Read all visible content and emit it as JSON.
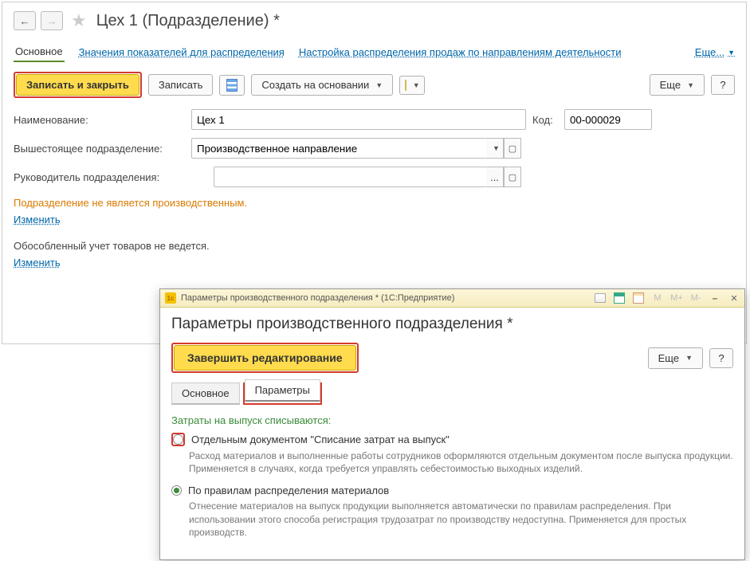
{
  "main": {
    "title": "Цех 1 (Подразделение) *",
    "tabs": {
      "main": "Основное",
      "link1": "Значения показателей для распределения",
      "link2": "Настройка распределения продаж по направлениям деятельности",
      "more": "Еще..."
    },
    "toolbar": {
      "save_close": "Записать и закрыть",
      "save": "Записать",
      "create_on": "Создать на основании",
      "more": "Еще",
      "help": "?"
    },
    "fields": {
      "name_label": "Наименование:",
      "name_value": "Цех 1",
      "code_label": "Код:",
      "code_value": "00-000029",
      "parent_label": "Вышестоящее подразделение:",
      "parent_value": "Производственное направление",
      "chief_label": "Руководитель подразделения:",
      "chief_value": ""
    },
    "info": {
      "not_prod": "Подразделение не является производственным.",
      "change": "Изменить",
      "sep_acct": "Обособленный учет товаров не ведется."
    }
  },
  "dialog": {
    "window_title": "Параметры производственного подразделения * (1С:Предприятие)",
    "heading": "Параметры производственного подразделения *",
    "finish": "Завершить редактирование",
    "more": "Еще",
    "help": "?",
    "tabs": {
      "main": "Основное",
      "params": "Параметры"
    },
    "section_title": "Затраты на выпуск списываются:",
    "opt1": {
      "label": "Отдельным документом \"Списание затрат на выпуск\"",
      "desc": "Расход материалов и выполненные работы сотрудников оформляются отдельным документом после выпуска продукции. Применяется в случаях, когда требуется управлять себестоимостью выходных изделий."
    },
    "opt2": {
      "label": "По правилам распределения материалов",
      "desc": "Отнесение материалов на выпуск продукции выполняется автоматически по правилам распределения. При использовании этого способа регистрация трудозатрат по производству недоступна. Применяется для простых производств."
    },
    "tb_icons": {
      "m": "M",
      "mp": "M+",
      "mm": "M-"
    }
  }
}
